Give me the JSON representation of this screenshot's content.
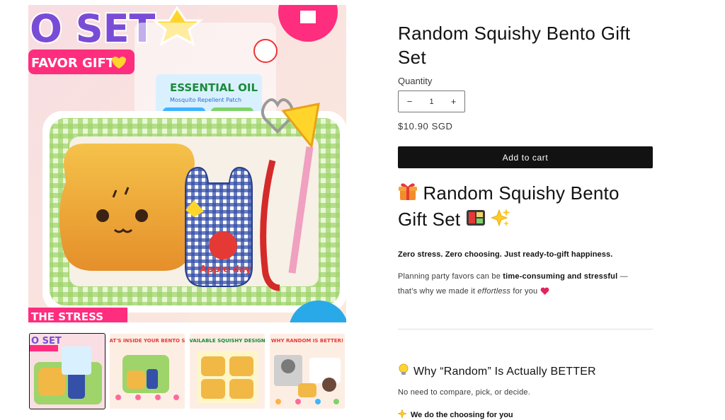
{
  "gallery": {
    "main_image": {
      "alt": "Random Squishy Bento Gift Set product photo",
      "banner_top": "O SET",
      "banner_favor": "FAVOR GIFT!",
      "pack_title": "ESSENTIAL OIL",
      "pack_subtitle": "Mosquito Repellent Patch",
      "bag_text": "Apple day",
      "banner_bottom": "THE STRESS"
    },
    "thumbnails": [
      {
        "label": "O SET",
        "sub": "FAVOR GIFT"
      },
      {
        "label": "WHAT'S INSIDE YOUR BENTO SET?"
      },
      {
        "label": "AVAILABLE SQUISHY DESIGNS"
      },
      {
        "label": "WHY RANDOM IS BETTER!"
      }
    ]
  },
  "product": {
    "title": "Random Squishy Bento Gift Set",
    "quantity_label": "Quantity",
    "quantity_value": "1",
    "minus": "−",
    "plus": "+",
    "price": "$10.90 SGD",
    "add_to_cart": "Add to cart"
  },
  "description": {
    "heading_text": "Random Squishy Bento Gift Set",
    "lead": "Zero stress. Zero choosing. Just ready-to-gift happiness.",
    "para_1": "Planning party favors can be ",
    "para_bold": "time-consuming and stressful",
    "para_2": " —",
    "para_3": "that’s why we made it ",
    "para_italic": "effortless",
    "para_4": " for you",
    "sub_heading": "Why “Random” Is Actually BETTER",
    "para_5": "No need to compare, pick, or decide.",
    "bullet": "We do the choosing for you"
  },
  "icons": [
    "gift-icon",
    "bento-icon",
    "sparkles-icon",
    "heart-icon",
    "lightbulb-icon",
    "sparkle-icon"
  ],
  "colors": {
    "button_bg": "#121212",
    "button_text": "#ffffff",
    "text": "#121212",
    "muted": "#3a3a3a",
    "heart": "#e0245e"
  }
}
